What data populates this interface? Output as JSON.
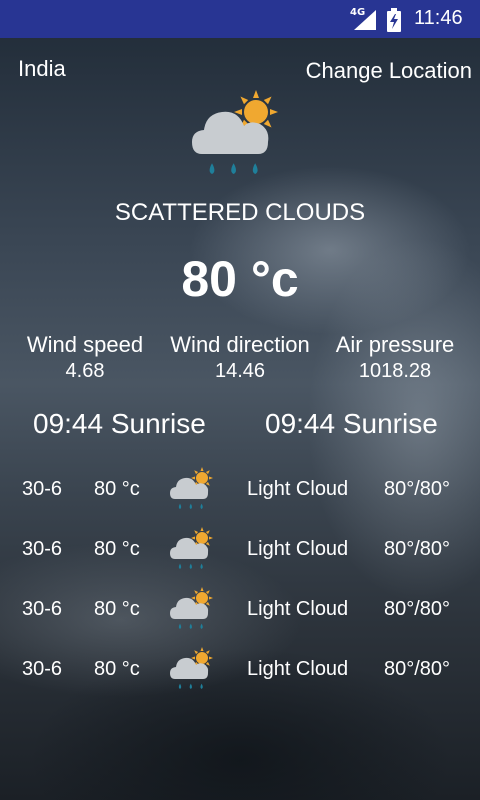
{
  "status_bar": {
    "network": "4G",
    "time": "11:46",
    "icons": [
      "signal-icon",
      "battery-charging-icon"
    ]
  },
  "header": {
    "location": "India",
    "change_location": "Change Location"
  },
  "current": {
    "icon": "cloud-sun-rain-icon",
    "condition": "SCATTERED CLOUDS",
    "temperature": "80 °c"
  },
  "stats": [
    {
      "label": "Wind speed",
      "value": "4.68"
    },
    {
      "label": "Wind direction",
      "value": "14.46"
    },
    {
      "label": "Air pressure",
      "value": "1018.28"
    }
  ],
  "sun": {
    "left": "09:44 Sunrise",
    "right": "09:44 Sunrise"
  },
  "forecast": [
    {
      "date": "30-6",
      "temp": "80 °c",
      "icon": "cloud-sun-rain-icon",
      "desc": "Light Cloud",
      "range": "80°/80°"
    },
    {
      "date": "30-6",
      "temp": "80 °c",
      "icon": "cloud-sun-rain-icon",
      "desc": "Light Cloud",
      "range": "80°/80°"
    },
    {
      "date": "30-6",
      "temp": "80 °c",
      "icon": "cloud-sun-rain-icon",
      "desc": "Light Cloud",
      "range": "80°/80°"
    },
    {
      "date": "30-6",
      "temp": "80 °c",
      "icon": "cloud-sun-rain-icon",
      "desc": "Light Cloud",
      "range": "80°/80°"
    }
  ],
  "colors": {
    "status_bar": "#283593",
    "sun": "#f0a830",
    "cloud": "#c8ccd0",
    "rain": "#1f7f9a"
  }
}
